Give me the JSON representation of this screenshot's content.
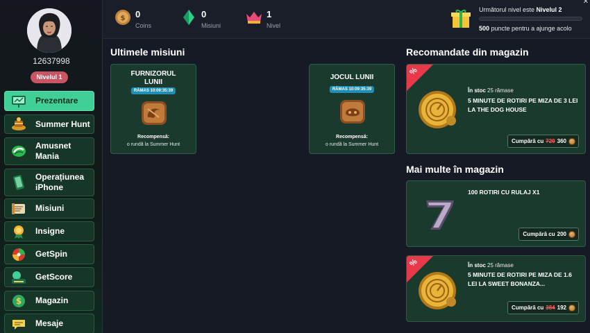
{
  "user": {
    "id": "12637998",
    "level_badge": "Nivelul 1"
  },
  "sidebar": {
    "items": [
      {
        "label": "Prezentare",
        "icon": "presentation-icon",
        "active": true
      },
      {
        "label": "Summer Hunt",
        "icon": "treasure-icon",
        "active": false
      },
      {
        "label": "Amusnet Mania",
        "icon": "amusnet-icon",
        "active": false
      },
      {
        "label": "Operațiunea iPhone",
        "icon": "iphone-icon",
        "active": false
      },
      {
        "label": "Misiuni",
        "icon": "missions-icon",
        "active": false
      },
      {
        "label": "Insigne",
        "icon": "badge-icon",
        "active": false
      },
      {
        "label": "GetSpin",
        "icon": "wheel-icon",
        "active": false
      },
      {
        "label": "GetScore",
        "icon": "score-icon",
        "active": false
      },
      {
        "label": "Magazin",
        "icon": "store-icon",
        "active": false
      },
      {
        "label": "Mesaje",
        "icon": "messages-icon",
        "active": false
      }
    ]
  },
  "stats": {
    "coins": {
      "value": "0",
      "label": "Coins"
    },
    "gems": {
      "value": "0",
      "label": "Misiuni"
    },
    "level": {
      "value": "1",
      "label": "Nivel"
    }
  },
  "next_level": {
    "text_prefix": "Următorul nivel este ",
    "text_level": "Nivelul 2",
    "points_value": "500",
    "points_text": " puncte pentru a ajunge acolo",
    "progress": 0
  },
  "missions": {
    "title": "Ultimele misiuni",
    "cards": [
      {
        "title": "FURNIZORUL LUNII",
        "timer": "RĂMAS 10:09:35:39",
        "reward_label": "Recompensă:",
        "reward_text": "o rundă la Summer Hunt"
      },
      {
        "title": "JOCUL LUNII",
        "timer": "RĂMAS 10:09:35:39",
        "reward_label": "Recompensă:",
        "reward_text": "o rundă la Summer Hunt"
      }
    ]
  },
  "recommended": {
    "title": "Recomandate din magazin",
    "item": {
      "stock_label": "În stoc",
      "stock_value": "25 rămase",
      "name": "5 MINUTE DE ROTIRI PE MIZA DE 3 LEI LA THE DOG HOUSE",
      "buy_label": "Cumpără cu",
      "old_price": "720",
      "price": "360",
      "discount": "%"
    }
  },
  "more": {
    "title": "Mai multe în magazin",
    "items": [
      {
        "name": "100 ROTIRI CU RULAJ X1",
        "buy_label": "Cumpără cu",
        "price": "200"
      },
      {
        "stock_label": "În stoc",
        "stock_value": "25 rămase",
        "name": "5 MINUTE DE ROTIRI PE MIZA DE 1.6 LEI LA SWEET BONANZA...",
        "buy_label": "Cumpără cu",
        "old_price": "384",
        "price": "192",
        "discount": "%"
      }
    ]
  },
  "colors": {
    "accent": "#3fcf97",
    "card_bg": "#1b3a2e",
    "badge": "#c85563",
    "ribbon": "#e8394a",
    "timer": "#1f8fb3"
  }
}
